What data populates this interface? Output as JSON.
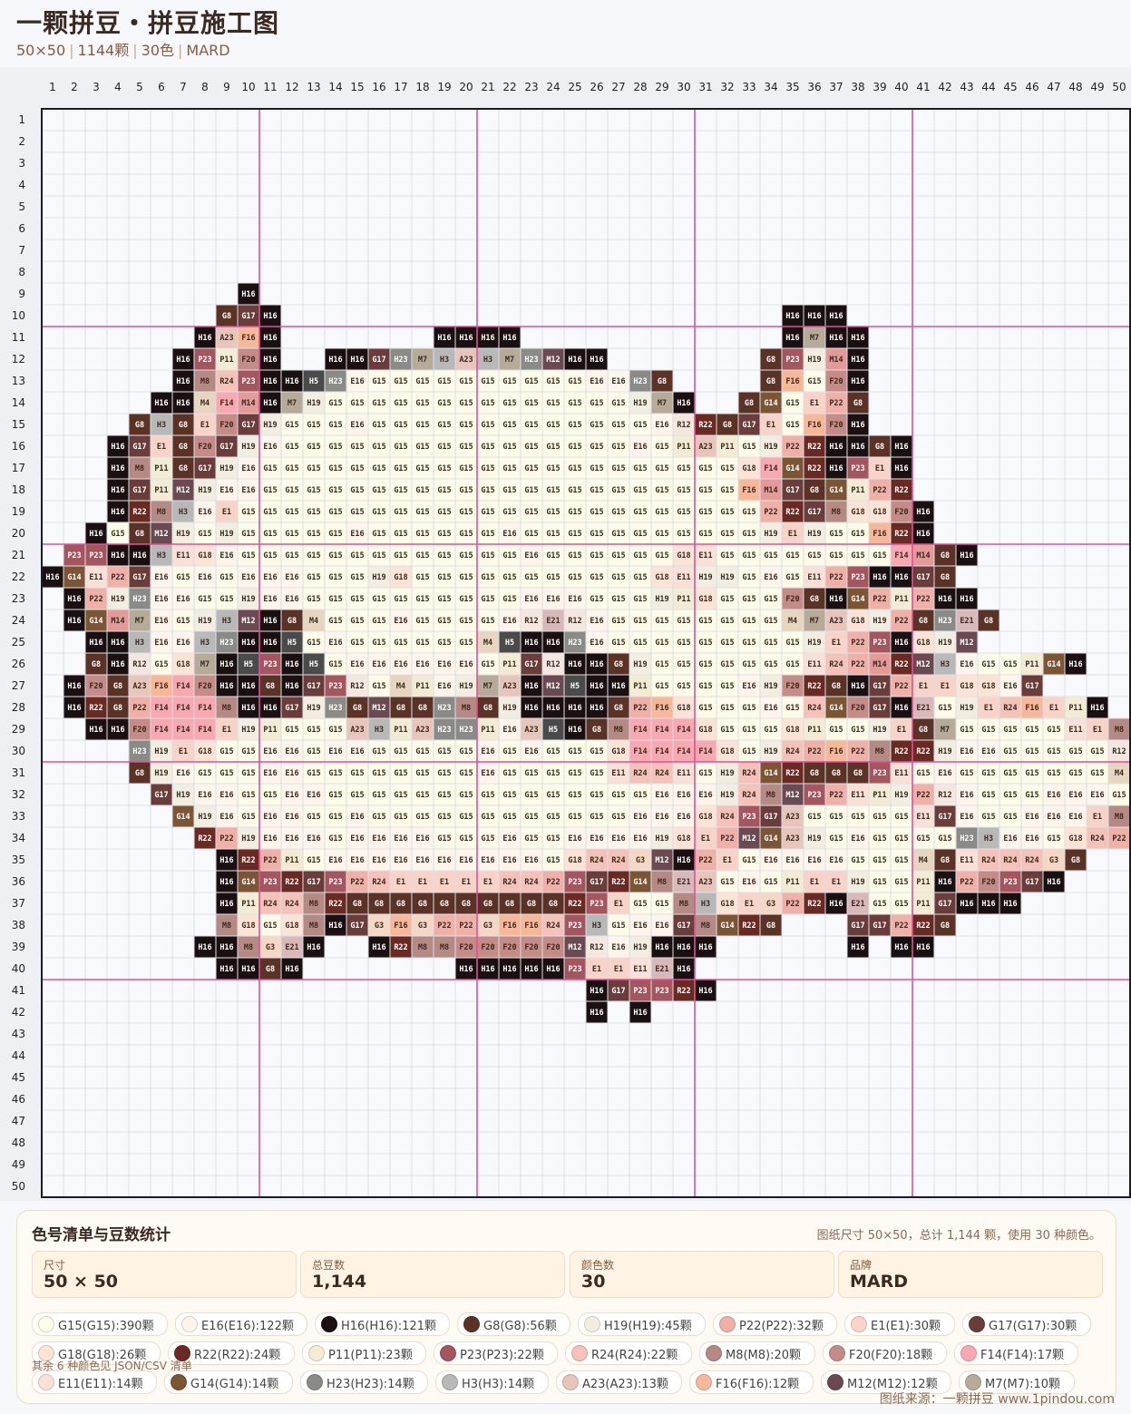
{
  "header": {
    "title": "一颗拼豆・拼豆施工图",
    "subtitle_parts": [
      "50×50",
      "1144颗",
      "30色",
      "MARD"
    ]
  },
  "grid": {
    "cols": 50,
    "rows": 50,
    "colors": {
      "G15": "#fbfbe8",
      "E16": "#fdf5ec",
      "H16": "#1a1012",
      "G8": "#5a3326",
      "H19": "#f1eee1",
      "P22": "#efb0a8",
      "E1": "#f8d3c8",
      "G17": "#6a3c3a",
      "G18": "#fbe3d5",
      "R22": "#6a2a22",
      "P11": "#f1ecd3",
      "P23": "#a5555e",
      "R24": "#f4c2b8",
      "M8": "#b58a85",
      "F20": "#c58b86",
      "F14": "#f7a8b0",
      "E11": "#f9e1d8",
      "G14": "#7c5535",
      "H23": "#8a8a86",
      "H3": "#b8b8b8",
      "A23": "#e8c5ba",
      "F16": "#f6b898",
      "M12": "#6a4a50",
      "M7": "#b6ab98",
      "M14": "#e59a98",
      "R12": "#f3e7e0",
      "E21": "#d9b8ba",
      "H5": "#4a4a4a",
      "M4": "#e6d6c0",
      "G3": "#f4d7c4"
    },
    "rows_data": {
      "9": "10:H16",
      "10": "9:G8 G17 H16|35:H16 H16 H16",
      "11": "8:H16 A23 F16 H16|19:H16 H16 H16 H16|35:H16 M7 H16 H16",
      "12": "7:H16 P23 P11 F20 H16|14:H16 H16 G17 H23 M7 H3 A23 H3 M7 H23 M12 H16 H16|34:G8 P23 H19 M14 H16",
      "13": "7:H16 M8 R24 P23 H16 H16 H5 H23 E16 G15 G15 G15 G15 G15 G15 G15 G15 G15 G15 E16 E16 H23 G8|34:G8 F16 G15 F20 H16",
      "14": "6:H16 H16 M4 F14 M14 H16 M7 H19 G15 G15 G15 G15 G15 G15 G15 G15 G15 G15 G15 G15 G15 G15 H19 M7 H16|33:G8 G14 G15 E1 P22 G8",
      "15": "5:G8 H3 G8 E1 F20 G17 H19 G15 G15 G15 E16 G15 G15 G15 G15 G15 G15 G15 G15 G15 G15 G15 G15 G15 E16 R12 R22 G8 G17 E1 G15 F16 F20 H16",
      "16": "4:H16 G17 E1 G8 F20 G17 H19 E16 G15 G15 G15 G15 G15 G15 G15 G15 G15 G15 G15 G15 G15 G15 G15 G15 E16 G15 P11 A23 P11 G15 H19 P22 R22 H16 H16 G8 H16",
      "17": "4:H16 M8 P11 G8 G17 H19 E16 G15 G15 G15 G15 G15 G15 G15 G15 G15 G15 G15 G15 G15 G15 G15 G15 G15 G15 G15 G15 G15 G15 G18 F14 G14 R22 H16 P23 E1 H16",
      "18": "4:H16 G17 P11 M12 H19 E16 E16 G15 G15 G15 G15 G15 G15 G15 G15 G15 G15 G15 G15 G15 G15 G15 G15 G15 G15 G15 G15 G15 G15 F16 M14 G17 G8 G14 P11 P22 R22",
      "19": "4:H16 R22 M8 H3 E16 E1 G15 G15 G15 G15 G15 G15 G15 G15 G15 G15 G15 G15 G15 G15 G15 G15 G15 G15 G15 G15 G15 G15 G15 G15 P22 R22 G17 M8 G18 G18 F20 H16",
      "20": "3:H16 G15 G8 M12 H19 G15 H19 G15 G15 G15 G15 G15 E16 G15 G15 G15 G15 G15 G15 E16 G15 G15 G15 G15 G15 G15 G15 G15 G15 G15 G15 H19 E1 H19 G15 G15 F16 R22 H16",
      "21": "2:P23 P23 H16 H16 H3 E11 G18 E16 G15 G15 G15 G15 G15 G15 G15 G15 G15 G15 G15 G15 G15 E16 G15 G15 G15 G15 G15 G15 G18 E11 G15 G15 G15 G15 G15 G15 G15 G15 F14 M14 G8 H16",
      "22": "1:H16 G14 E11 P22 G17 E16 G15 E16 G15 E16 E16 E16 G15 G15 G15 H19 G18 G15 G15 G15 G15 G15 G15 G15 G15 G15 G15 G15 G18 E11 H19 H19 G15 E16 G15 E11 P22 P23 H16 H16 G17 G8",
      "23": "2:H16 P22 H19 H23 E16 E16 G15 G15 H19 E16 E16 G15 G15 G15 G15 G15 G15 G15 G15 G15 G15 E16 E16 E16 G15 G15 G15 H19 P11 G18 G15 G15 G15 F20 G8 H16 G14 P22 P11 P22 H16 H16",
      "24": "2:H16 G14 M14 M7 E16 G15 H19 H3 M12 H16 G8 M4 G15 G15 G15 E16 G15 G15 G15 G15 E16 R12 E21 R12 E16 G15 G15 G15 G15 G15 G15 G15 G15 M4 M7 A23 G18 H19 P22 G8 H23 E21 G8",
      "25": "3:H16 H16 H3 E16 E16 H3 H23 H16 H16 H5 G15 E16 G15 G15 G15 G15 G15 G15 M4 H5 H16 H16 H23 E16 G15 G15 G15 G15 G15 G15 G15 G15 G15 H19 E1 P22 P23 H16 G18 H19 M12",
      "26": "3:G8 H16 R12 G15 G18 M7 H16 H5 P23 H16 H5 G15 E16 E16 E16 E16 E16 E16 G15 P11 G17 R12 H16 H16 G8 H19 G15 G15 G15 G15 G15 G15 G15 E11 R24 P22 M14 R22 M12 H3 E16 G15 G15 P11 G14 H16",
      "27": "2:H16 F20 G8 A23 F16 F14 F20 H16 H16 G8 H16 G17 P23 R12 G15 M4 P11 E16 H19 M7 A23 H16 M12 H5 H16 H16 P11 G15 G15 G15 G15 E16 H19 F20 R22 G8 H16 G17 P22 E1 E1 G18 G18 E16 G17",
      "28": "2:H16 R22 G8 P22 F14 F14 F14 M8 H16 H16 G17 H19 H23 G8 M12 G8 G8 H23 M8 G8 H19 H16 H16 H16 H16 G8 P22 F16 G18 G15 G15 G15 E16 G15 R24 G14 F20 G17 H16 E21 G15 H19 E1 R24 F16 E1 P11 H16",
      "29": "3:H16 H16 F20 F14 F14 F14 E1 H19 P11 G15 G15 G15 A23 H3 P11 A23 H23 H23 P11 E16 A23 H5 H16 G8 M8 F14 F14 F14 G18 G15 G15 G15 G18 P11 G15 G15 H19 E1 G8 M7 G15 G15 G15 G15 G15 E11 E1 M8",
      "30": "5:H23 H19 E1 G18 G15 G15 E16 E16 G15 E16 E16 G15 G15 G15 G15 G15 E16 G15 E16 G15 G15 G15 G18 F14 F14 F14 F14 G18 G15 H19 R24 P22 F16 P22 M8 R22 R22 H19 E16 E16 G15 G15 G15 G15 G15 R12 G8",
      "31": "5:G8 H19 E16 G15 G15 G15 E16 E16 G15 G15 G15 G15 G15 G15 G15 G15 E16 G15 G15 G15 G15 G15 E11 R24 R24 E11 G15 H19 R24 G14 R22 G8 G8 G8 P23 E11 G15 E16 G15 G15 G15 G15 G15 G15 G15 M4 G8",
      "32": "6:G17 H19 E16 E16 G15 G15 E16 E16 G15 G15 G15 G15 G15 G15 G15 G15 G15 G15 G15 G15 G15 G15 G15 E16 E16 E16 H19 R24 M8 M12 P23 P22 E11 P11 H19 P22 R12 E16 G15 G15 G15 E16 E16 E16 G15 P22 G8",
      "33": "7:G14 H19 E16 G15 E16 E16 G15 G15 E16 G15 G15 G15 G15 G15 G15 G15 G15 G15 G15 G15 G15 E16 E16 E16 G18 R24 P23 G17 A23 G15 G15 G15 G15 G15 E11 G17 E16 G15 G15 E16 E16 E16 E1 M8",
      "34": "8:R22 P22 H19 E16 E16 E16 G15 E16 E16 E16 E16 G15 G15 G15 E16 G15 G15 E16 E16 E16 E16 H19 G18 E1 P22 M12 G14 A23 H19 G15 E16 G15 G15 G15 G15 H23 H3 E16 E16 G15 G18 R24 P22 G8",
      "35": "9:H16 R22 P22 P11 G15 E16 E16 E16 E16 E16 E16 E16 E16 E16 E16 G15 G18 R24 R24 G3 M12 H16 P22 E1 G15 E16 E16 E16 E16 G15 G15 G15 M4 G8 E11 R24 R24 R24 G3 G8",
      "36": "9:H16 G14 P23 R22 G17 P23 P22 R24 E1 E1 E1 E1 E1 R24 R24 P22 P23 G17 R22 G14 M8 E21 A23 G15 E16 G15 P11 E1 E1 H19 G15 G15 P11 H16 P22 F20 P23 G17 H16",
      "37": "9:H16 P11 R24 R24 M8 R22 G8 G8 G8 G8 G8 G8 G8 G8 G8 G8 R22 P23 E1 G15 G15 M8 H3 G18 E1 G3 P22 R22 H16 E21 G15 G15 P11 G17 H16 H16 H16",
      "38": "9:M8 G18 G15 G18 M8 H16 G17 G3 F16 G3 P22 P22 G3 F16 F16 R24 P23 H3 G15 E16 E16 G17 M8 G14 R22 G8|38:G17 G17 P22 R22 G8",
      "39": "8:H16 H16 M8 G3 E21 H16|16:H16 R22 M8 M8 F20 F20 F20 F20 F20 M12 R12 E16 H19 H16 H16 H16|38:H16|40:H16 H16",
      "40": "9:H16 H16 G8 H16|20:H16 H16 H16 H16 H16 P23 E1 E1 E11 E21 H16",
      "41": "26:H16 G17 P23 P23 R22 H16",
      "42": "26:H16|28:H16"
    }
  },
  "legend": {
    "title": "色号清单与豆数统计",
    "note": "图纸尺寸 50×50，总计 1,144 颗，使用 30 种颜色。",
    "stats": [
      {
        "label": "尺寸",
        "value": "50 × 50"
      },
      {
        "label": "总豆数",
        "value": "1,144"
      },
      {
        "label": "颜色数",
        "value": "30"
      },
      {
        "label": "品牌",
        "value": "MARD"
      }
    ],
    "chips": [
      {
        "code": "G15",
        "text": "G15(G15):390颗",
        "color": "#fbfbe8"
      },
      {
        "code": "E16",
        "text": "E16(E16):122颗",
        "color": "#fdf5ec"
      },
      {
        "code": "H16",
        "text": "H16(H16):121颗",
        "color": "#1a1012"
      },
      {
        "code": "G8",
        "text": "G8(G8):56颗",
        "color": "#5a3326"
      },
      {
        "code": "H19",
        "text": "H19(H19):45颗",
        "color": "#f1eee1"
      },
      {
        "code": "P22",
        "text": "P22(P22):32颗",
        "color": "#efb0a8"
      },
      {
        "code": "E1",
        "text": "E1(E1):30颗",
        "color": "#f8d3c8"
      },
      {
        "code": "G17",
        "text": "G17(G17):30颗",
        "color": "#6a3c3a"
      },
      {
        "code": "G18",
        "text": "G18(G18):26颗",
        "color": "#fbe3d5"
      },
      {
        "code": "R22",
        "text": "R22(R22):24颗",
        "color": "#6a2a22"
      },
      {
        "code": "P11",
        "text": "P11(P11):23颗",
        "color": "#f1ecd3"
      },
      {
        "code": "P23",
        "text": "P23(P23):22颗",
        "color": "#a5555e"
      },
      {
        "code": "R24",
        "text": "R24(R24):22颗",
        "color": "#f4c2b8"
      },
      {
        "code": "M8",
        "text": "M8(M8):20颗",
        "color": "#b58a85"
      },
      {
        "code": "F20",
        "text": "F20(F20):18颗",
        "color": "#c58b86"
      },
      {
        "code": "F14",
        "text": "F14(F14):17颗",
        "color": "#f7a8b0"
      },
      {
        "code": "E11",
        "text": "E11(E11):14颗",
        "color": "#f9e1d8"
      },
      {
        "code": "G14",
        "text": "G14(G14):14颗",
        "color": "#7c5535"
      },
      {
        "code": "H23",
        "text": "H23(H23):14颗",
        "color": "#8a8a86"
      },
      {
        "code": "H3",
        "text": "H3(H3):14颗",
        "color": "#b8b8b8"
      },
      {
        "code": "A23",
        "text": "A23(A23):13颗",
        "color": "#e8c5ba"
      },
      {
        "code": "F16",
        "text": "F16(F16):12颗",
        "color": "#f6b898"
      },
      {
        "code": "M12",
        "text": "M12(M12):12颗",
        "color": "#6a4a50"
      },
      {
        "code": "M7",
        "text": "M7(M7):10颗",
        "color": "#b6ab98"
      }
    ],
    "more_note": "其余 6 种颜色见 JSON/CSV 清单",
    "source": "图纸来源：一颗拼豆 www.1pindou.com"
  }
}
